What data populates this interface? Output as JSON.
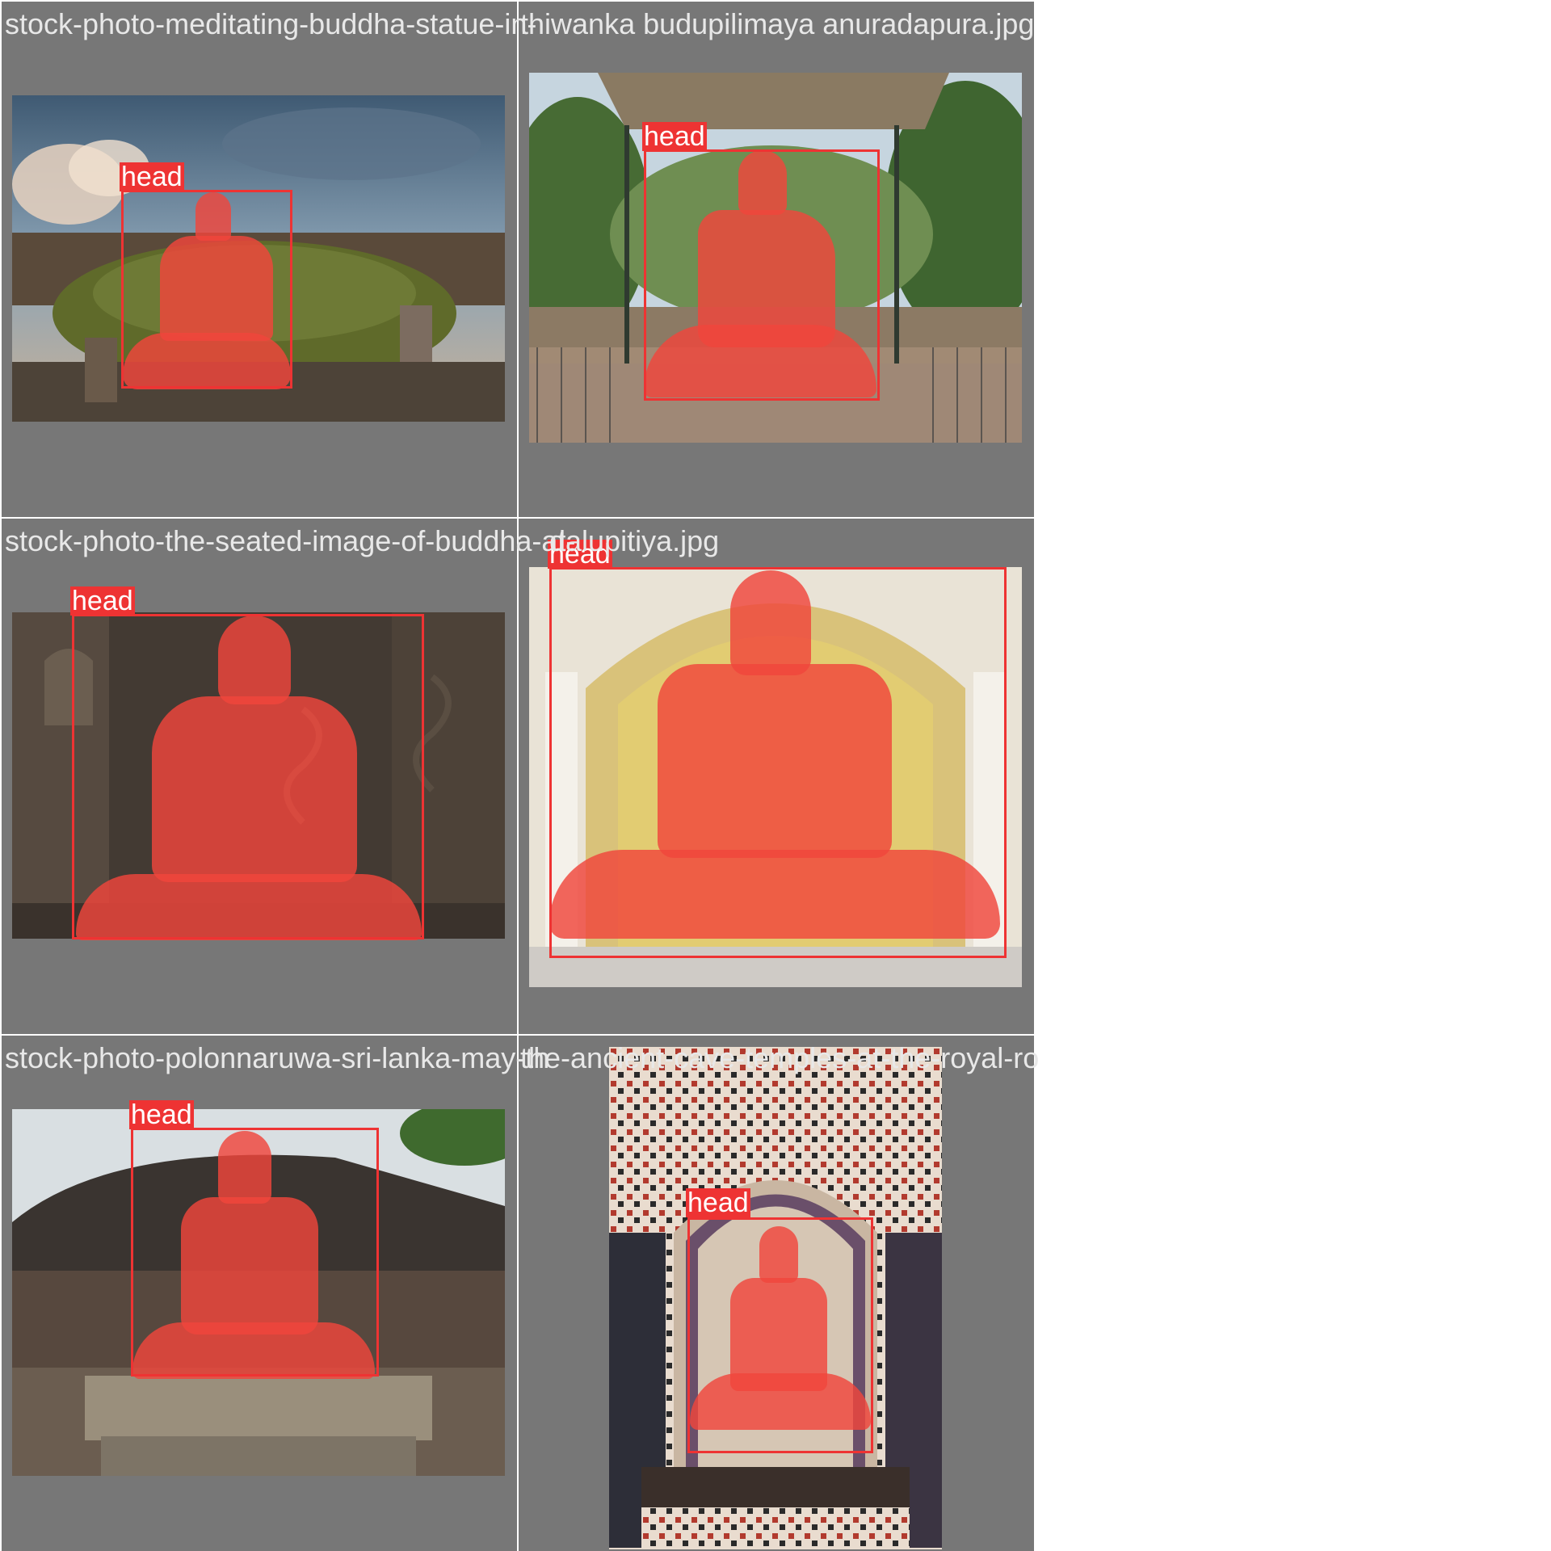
{
  "grid": {
    "background_color": "#777777",
    "accent_color": "#ee3333",
    "mask_color": "#f0463c"
  },
  "cells": [
    {
      "filename": "stock-photo-meditating-buddha-statue-in-",
      "label": "head",
      "scene": "stupa-ruins-under-cloudy-sky"
    },
    {
      "filename": "thiwanka budupilimaya anuradapura.jpg",
      "label": "head",
      "scene": "statue-under-shelter-in-park"
    },
    {
      "filename": "stock-photo-the-seated-image-of-buddha-at-",
      "label": "head",
      "scene": "rock-carved-wall-background"
    },
    {
      "filename": "dalupitiya.jpg",
      "label": "head",
      "scene": "arched-yellow-shrine"
    },
    {
      "filename": "stock-photo-polonnaruwa-sri-lanka-may-th",
      "label": "head",
      "scene": "brick-stupa-with-stone-pedestal"
    },
    {
      "filename": "the-ancient-cave-temples-at-the-royal-ro",
      "label": "head",
      "scene": "painted-cave-temple"
    }
  ]
}
